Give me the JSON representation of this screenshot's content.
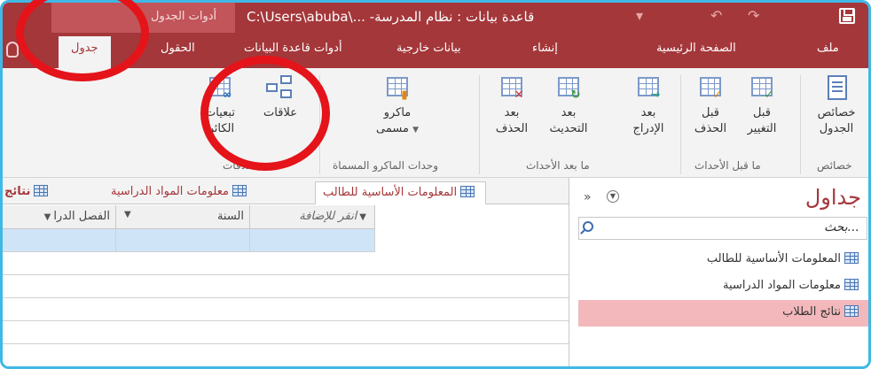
{
  "window": {
    "context_tab_label": "أدوات الجدول",
    "title": "C:\\Users\\abuba\\... -قاعدة بيانات : نظام المدرسة"
  },
  "ribbon_tabs": [
    "ملف",
    "الصفحة الرئيسية",
    "إنشاء",
    "بيانات خارجية",
    "أدوات قاعدة البيانات",
    "الحقول",
    "جدول"
  ],
  "active_tab": "جدول",
  "ribbon": {
    "props": {
      "label_1": "خصائص",
      "label_2": "الجدول",
      "group": "خصائص"
    },
    "before_change": {
      "label_1": "قبل",
      "label_2": "التغيير"
    },
    "before_delete": {
      "label_1": "قبل",
      "label_2": "الحذف"
    },
    "before_group": "ما قبل الأحداث",
    "after_insert": {
      "label_1": "بعد",
      "label_2": "الإدراج"
    },
    "after_update": {
      "label_1": "بعد",
      "label_2": "التحديث"
    },
    "after_delete": {
      "label_1": "بعد",
      "label_2": "الحذف"
    },
    "after_group": "ما بعد الأحداث",
    "named_macro": {
      "label_1": "ماكرو",
      "label_2": "مسمى"
    },
    "macro_group": "وحدات الماكرو المسماة",
    "relationships": {
      "label": "علاقات"
    },
    "dependencies": {
      "label_1": "تبعيات",
      "label_2": "الكائن"
    },
    "relations_group": "علاقات"
  },
  "doc_tabs": [
    "المعلومات الأساسية للطالب",
    "معلومات المواد الدراسية",
    "نتائج"
  ],
  "grid": {
    "headers": [
      "انقر للإضافة",
      "السنة",
      "الفصل الدرا"
    ]
  },
  "nav_pane": {
    "title": "جداول",
    "search_placeholder": "بحث...",
    "items": [
      "المعلومات الأساسية للطالب",
      "معلومات المواد الدراسية",
      "نتائج الطلاب"
    ]
  }
}
